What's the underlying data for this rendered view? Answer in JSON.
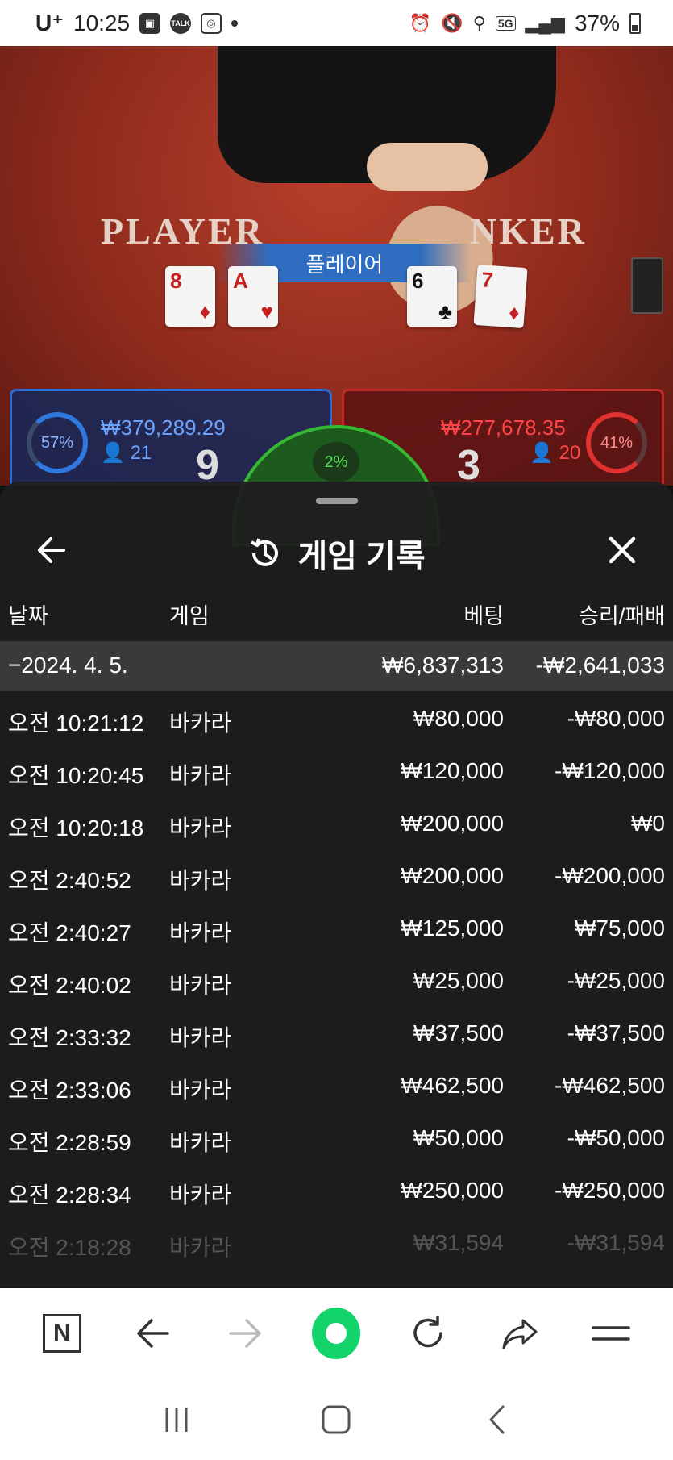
{
  "status_bar": {
    "carrier": "U⁺",
    "time": "10:25",
    "notif_icons": [
      "image-icon",
      "talk-icon",
      "instagram-icon"
    ],
    "talk_label": "TALK",
    "network": "5G",
    "battery": "37%"
  },
  "game": {
    "player_label": "PLAYER",
    "banker_label": "NKER",
    "result_banner": "플레이어",
    "player_cards": [
      {
        "rank": "8",
        "suit": "♦"
      },
      {
        "rank": "A",
        "suit": "♥"
      }
    ],
    "banker_cards": [
      {
        "rank": "6",
        "suit": "♣"
      },
      {
        "rank": "7",
        "suit": "♦"
      }
    ],
    "player_panel": {
      "pct": "57%",
      "amount": "₩379,289.29",
      "count": "21",
      "score": "9"
    },
    "banker_panel": {
      "pct": "41%",
      "amount": "₩277,678.35",
      "count": "20",
      "score": "3"
    },
    "tie_pct": "2%"
  },
  "history": {
    "title": "게임 기록",
    "columns": {
      "date": "날짜",
      "game": "게임",
      "bet": "베팅",
      "result": "승리/패배"
    },
    "summary": {
      "date": "−2024. 4. 5.",
      "bet": "₩6,837,313",
      "result": "-₩2,641,033"
    },
    "rows": [
      {
        "time": "오전 10:21:12",
        "game": "바카라",
        "bet": "₩80,000",
        "result": "-₩80,000"
      },
      {
        "time": "오전 10:20:45",
        "game": "바카라",
        "bet": "₩120,000",
        "result": "-₩120,000"
      },
      {
        "time": "오전 10:20:18",
        "game": "바카라",
        "bet": "₩200,000",
        "result": "₩0"
      },
      {
        "time": "오전 2:40:52",
        "game": "바카라",
        "bet": "₩200,000",
        "result": "-₩200,000"
      },
      {
        "time": "오전 2:40:27",
        "game": "바카라",
        "bet": "₩125,000",
        "result": "₩75,000"
      },
      {
        "time": "오전 2:40:02",
        "game": "바카라",
        "bet": "₩25,000",
        "result": "-₩25,000"
      },
      {
        "time": "오전 2:33:32",
        "game": "바카라",
        "bet": "₩37,500",
        "result": "-₩37,500"
      },
      {
        "time": "오전 2:33:06",
        "game": "바카라",
        "bet": "₩462,500",
        "result": "-₩462,500"
      },
      {
        "time": "오전 2:28:59",
        "game": "바카라",
        "bet": "₩50,000",
        "result": "-₩50,000"
      },
      {
        "time": "오전 2:28:34",
        "game": "바카라",
        "bet": "₩250,000",
        "result": "-₩250,000"
      },
      {
        "time": "오전 2:18:28",
        "game": "바카라",
        "bet": "₩31,594",
        "result": "-₩31,594"
      }
    ]
  },
  "browser": {
    "naver_label": "N",
    "icons": [
      "naver-icon",
      "back-arrow-icon",
      "forward-arrow-icon",
      "green-dot-icon",
      "refresh-icon",
      "share-icon",
      "menu-icon"
    ]
  },
  "system_nav": {
    "icons": [
      "recents-icon",
      "home-icon",
      "back-icon"
    ]
  }
}
